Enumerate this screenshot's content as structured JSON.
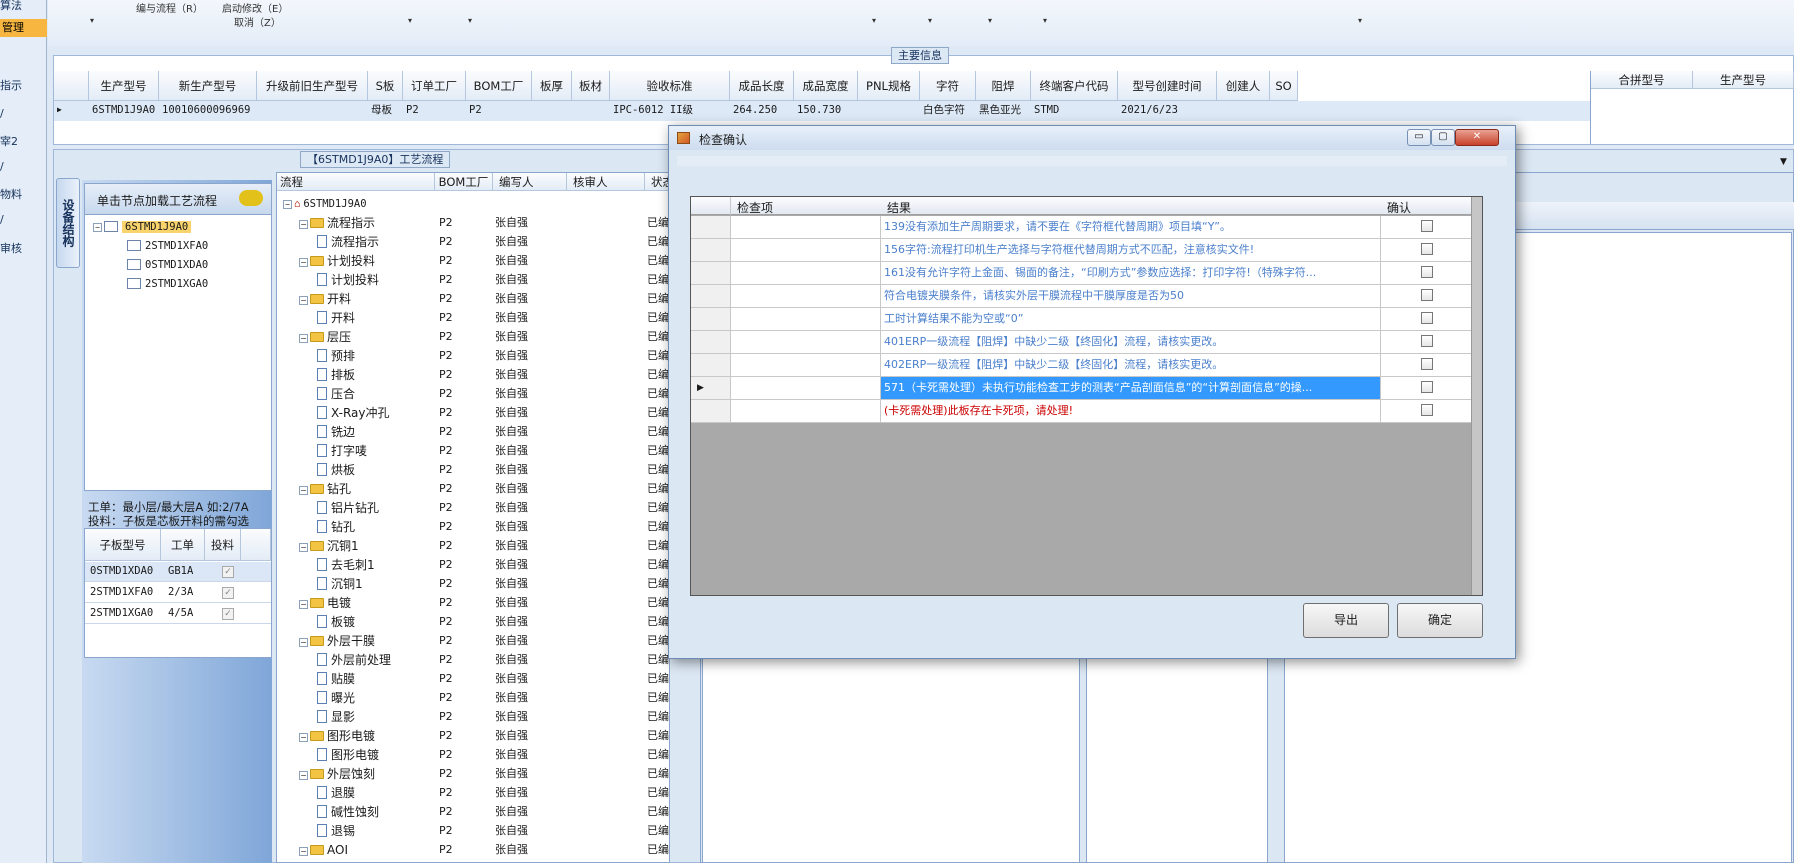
{
  "nav": {
    "items": [
      "算法",
      "管理",
      "指示",
      "/",
      "宰2",
      "/",
      "物料",
      "/",
      "审核"
    ]
  },
  "toolbar": {
    "menu1": "编与流程（R）",
    "menu2": "启动修改（E）",
    "menu3": "取消（Z）"
  },
  "main_info": {
    "title": "主要信息",
    "columns": [
      "生产型号",
      "新生产型号",
      "升级前旧生产型号",
      "S板",
      "订单工厂",
      "BOM工厂",
      "板厚",
      "板材",
      "验收标准",
      "成品长度",
      "成品宽度",
      "PNL规格",
      "字符",
      "阻焊",
      "终端客户代码",
      "型号创建时间",
      "创建人",
      "SO"
    ],
    "row": [
      "6STMD1J9A0",
      "10010600096969",
      "",
      "母板",
      "P2",
      "P2",
      "",
      "",
      "IPC-6012 II级",
      "264.250",
      "150.730",
      "",
      "白色字符",
      "黑色亚光",
      "STMD",
      "2021/6/23",
      "",
      ""
    ],
    "merge_columns": [
      "合拼型号",
      "生产型号"
    ]
  },
  "device_tab": "设备结构",
  "left_panel": {
    "header": "单击节点加载工艺流程",
    "tree_root": "6STMD1J9A0",
    "tree_children": [
      "2STMD1XFA0",
      "0STMD1XDA0",
      "2STMD1XGA0"
    ],
    "info_line1": "工单：最小层/最大层A 如:2/7A",
    "info_line2": "投料：子板是芯板开料的需勾选",
    "sub_columns": [
      "子板型号",
      "工单",
      "投料"
    ],
    "sub_rows": [
      {
        "model": "0STMD1XDA0",
        "wo": "GB1A"
      },
      {
        "model": "2STMD1XFA0",
        "wo": "2/3A"
      },
      {
        "model": "2STMD1XGA0",
        "wo": "4/5A"
      }
    ]
  },
  "flow": {
    "title": "【6STMD1J9A0】工艺流程",
    "columns": [
      "流程",
      "BOM工厂",
      "编写人",
      "核审人",
      "状态"
    ],
    "root": "6STMD1J9A0",
    "factory": "P2",
    "writer": "张自强",
    "status": "已编",
    "rows": [
      {
        "label": "流程指示",
        "t": "f"
      },
      {
        "label": "流程指示",
        "t": "d"
      },
      {
        "label": "计划投料",
        "t": "f"
      },
      {
        "label": "计划投料",
        "t": "d"
      },
      {
        "label": "开料",
        "t": "f"
      },
      {
        "label": "开料",
        "t": "d"
      },
      {
        "label": "层压",
        "t": "f"
      },
      {
        "label": "预排",
        "t": "d"
      },
      {
        "label": "排板",
        "t": "d"
      },
      {
        "label": "压合",
        "t": "d"
      },
      {
        "label": "X-Ray冲孔",
        "t": "d"
      },
      {
        "label": "铣边",
        "t": "d"
      },
      {
        "label": "打字唛",
        "t": "d"
      },
      {
        "label": "烘板",
        "t": "d"
      },
      {
        "label": "钻孔",
        "t": "f"
      },
      {
        "label": "铝片钻孔",
        "t": "d"
      },
      {
        "label": "钻孔",
        "t": "d"
      },
      {
        "label": "沉铜1",
        "t": "f"
      },
      {
        "label": "去毛刺1",
        "t": "d"
      },
      {
        "label": "沉铜1",
        "t": "d"
      },
      {
        "label": "电镀",
        "t": "f"
      },
      {
        "label": "板镀",
        "t": "d"
      },
      {
        "label": "外层干膜",
        "t": "f"
      },
      {
        "label": "外层前处理",
        "t": "d"
      },
      {
        "label": "贴膜",
        "t": "d"
      },
      {
        "label": "曝光",
        "t": "d"
      },
      {
        "label": "显影",
        "t": "d"
      },
      {
        "label": "图形电镀",
        "t": "f"
      },
      {
        "label": "图形电镀",
        "t": "d"
      },
      {
        "label": "外层蚀刻",
        "t": "f"
      },
      {
        "label": "退膜",
        "t": "d"
      },
      {
        "label": "碱性蚀刻",
        "t": "d"
      },
      {
        "label": "退锡",
        "t": "d"
      },
      {
        "label": "AOI",
        "t": "f"
      }
    ]
  },
  "dialog": {
    "title": "检查确认",
    "columns": [
      "检查项",
      "结果",
      "确认"
    ],
    "rows": [
      "139没有添加生产周期要求，请不要在《字符框代替周期》项目填“Y”。",
      "156字符:流程打印机生产选择与字符框代替周期方式不匹配，注意核实文件!",
      "161没有允许字符上金面、锡面的备注，“印刷方式”参数应选择：打印字符!（特殊字符...",
      "符合电镀夹膜条件，请核实外层干膜流程中干膜厚度是否为50",
      "工时计算结果不能为空或“0”",
      "401ERP一级流程【阻焊】中缺少二级【终固化】流程，请核实更改。",
      "402ERP一级流程【阻焊】中缺少二级【终固化】流程，请核实更改。",
      "571（卡死需处理）未执行功能检查工步的测表“产品剖面信息”的“计算剖面信息”的操...",
      "(卡死需处理)此板存在卡死项，请处理!"
    ],
    "selected_row": 7,
    "error_row": 8,
    "export_label": "导出",
    "ok_label": "确定",
    "minimize": "▭",
    "maximize": "▢",
    "close": "✕"
  },
  "colors": {
    "accent": "#3399ff",
    "nav_sel": "#f6b640",
    "error": "#cc0000",
    "result_text": "#4a7fcc"
  }
}
